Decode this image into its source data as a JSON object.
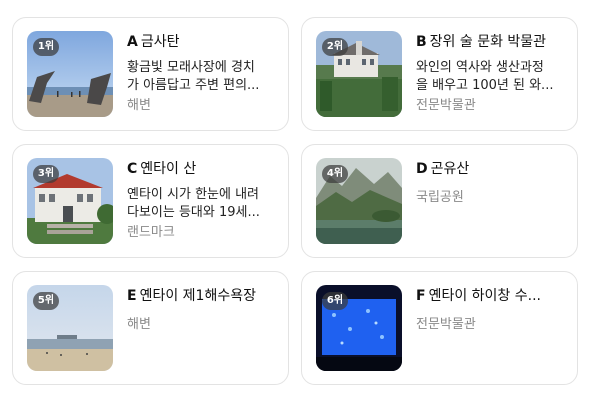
{
  "cards": [
    {
      "rank": "1위",
      "letter": "A",
      "name": "금사탄",
      "desc_line1": "황금빛 모래사장에 경치",
      "desc_line2": "가 아름답고 주변 편의...",
      "category": "해변"
    },
    {
      "rank": "2위",
      "letter": "B",
      "name": "장위 술 문화 박물관",
      "desc_line1": "와인의 역사와 생산과정",
      "desc_line2": "을 배우고 100년 된 와...",
      "category": "전문박물관"
    },
    {
      "rank": "3위",
      "letter": "C",
      "name": "옌타이 산",
      "desc_line1": "옌타이 시가 한눈에 내려",
      "desc_line2": "다보이는 등대와 19세...",
      "category": "랜드마크"
    },
    {
      "rank": "4위",
      "letter": "D",
      "name": "곤유산",
      "category": "국립공원"
    },
    {
      "rank": "5위",
      "letter": "E",
      "name": "옌타이 제1해수욕장",
      "category": "해변"
    },
    {
      "rank": "6위",
      "letter": "F",
      "name": "옌타이 하이창 수...",
      "category": "전문박물관"
    }
  ]
}
